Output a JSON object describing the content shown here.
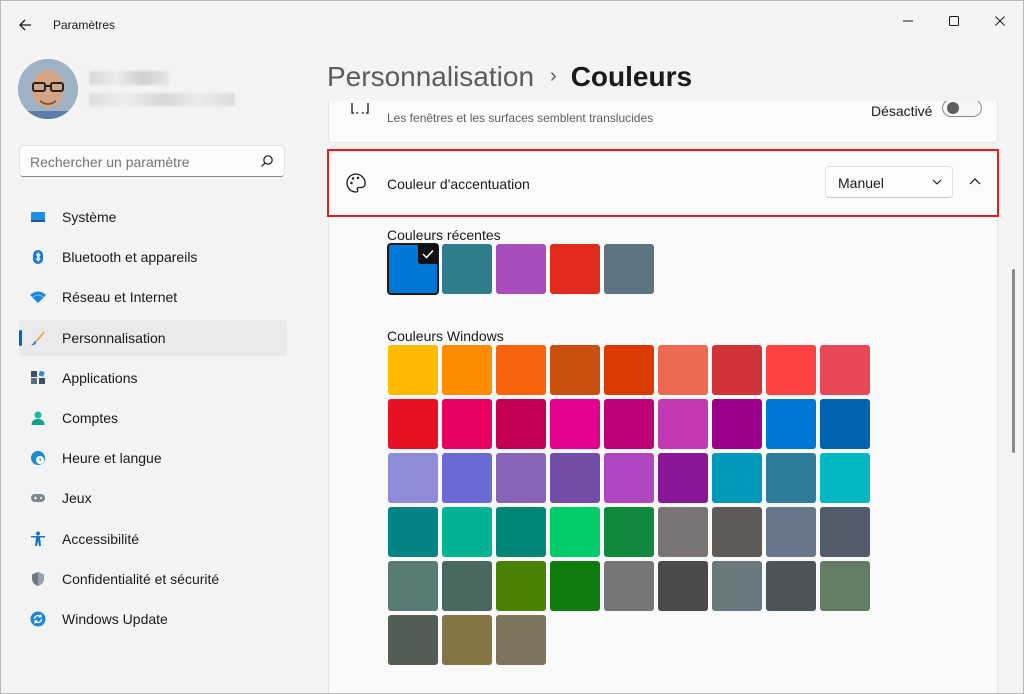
{
  "window": {
    "title": "Paramètres",
    "controls": [
      "minimize-icon",
      "maximize-icon",
      "close-icon"
    ]
  },
  "search": {
    "placeholder": "Rechercher un paramètre"
  },
  "sidebar": {
    "items": [
      {
        "label": "Système",
        "icon": "system-icon",
        "color": "#1b90e0"
      },
      {
        "label": "Bluetooth et appareils",
        "icon": "bluetooth-icon",
        "color": "#1b78d0"
      },
      {
        "label": "Réseau et Internet",
        "icon": "wifi-icon",
        "color": "#1a86d9"
      },
      {
        "label": "Personnalisation",
        "icon": "brush-icon",
        "color": "#e9824a",
        "active": true
      },
      {
        "label": "Applications",
        "icon": "apps-icon",
        "color": "#5a6e86"
      },
      {
        "label": "Comptes",
        "icon": "accounts-icon",
        "color": "#20b5a0"
      },
      {
        "label": "Heure et langue",
        "icon": "clock-globe-icon",
        "color": "#1a8ad9"
      },
      {
        "label": "Jeux",
        "icon": "gamepad-icon",
        "color": "#7b8793"
      },
      {
        "label": "Accessibilité",
        "icon": "accessibility-icon",
        "color": "#1973c7"
      },
      {
        "label": "Confidentialité et sécurité",
        "icon": "shield-icon",
        "color": "#6f7781"
      },
      {
        "label": "Windows Update",
        "icon": "update-icon",
        "color": "#1a86d9"
      }
    ]
  },
  "breadcrumb": {
    "parent": "Personnalisation",
    "separator": "›",
    "current": "Couleurs"
  },
  "transparency": {
    "description": "Les fenêtres et les surfaces semblent translucides",
    "state": "Désactivé"
  },
  "accent": {
    "label": "Couleur d'accentuation",
    "mode": "Manuel",
    "recent_title": "Couleurs récentes",
    "windows_title": "Couleurs Windows",
    "recent_colors": [
      "#0078d7",
      "#2d7d8a",
      "#a94dbd",
      "#e22a1d",
      "#5e7380"
    ],
    "selected_recent": 0,
    "windows_colors": [
      "#ffb900",
      "#ff8c00",
      "#f7630c",
      "#ca5010",
      "#da3b01",
      "#ef6950",
      "#d13438",
      "#ff4343",
      "#e74856",
      "#e81123",
      "#ea005e",
      "#c30052",
      "#e3008c",
      "#bf0077",
      "#c239b3",
      "#9a0089",
      "#0078d7",
      "#0063b1",
      "#8e8cd8",
      "#6b69d6",
      "#8764b8",
      "#744da9",
      "#b146c2",
      "#881798",
      "#0099bc",
      "#2d7d9a",
      "#00b7c3",
      "#038387",
      "#00b294",
      "#018574",
      "#00cc6a",
      "#10893e",
      "#7a7574",
      "#5d5a58",
      "#68768a",
      "#515c6b",
      "#567c73",
      "#486860",
      "#498205",
      "#107c10",
      "#767676",
      "#4c4a48",
      "#69797e",
      "#4a5459",
      "#647c64",
      "#525e54",
      "#847545",
      "#7e735f"
    ]
  }
}
